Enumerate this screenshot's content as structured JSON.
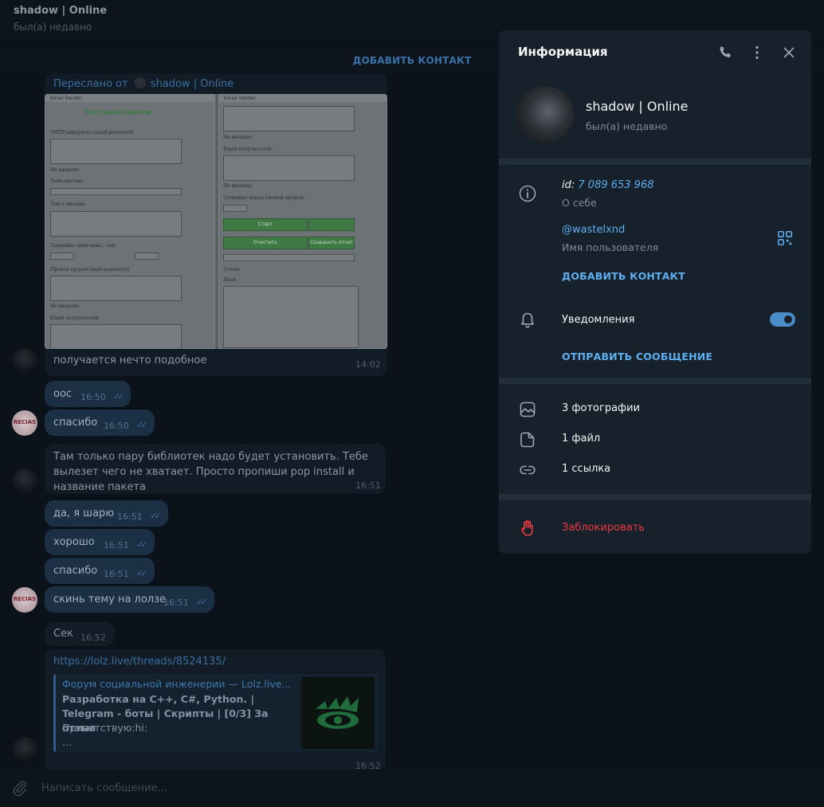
{
  "chat": {
    "title": "shadow | Online",
    "status": "был(а) недавно",
    "add_contact": "ДОБАВИТЬ КОНТАКТ",
    "forwarded_label": "Переслано от",
    "forwarded_from": "shadow | Online",
    "messages": [
      {
        "text": "получается нечто подобное",
        "time": "14:02"
      },
      {
        "text": "оос",
        "time": "16:50"
      },
      {
        "text": "спасибо",
        "time": "16:50"
      },
      {
        "text": "Там только пару библиотек надо будет установить. Тебе вылезет чего не хватает. Просто пропиши pop install и название пакета",
        "time": "16:51"
      },
      {
        "text": "да, я шарю",
        "time": "16:51"
      },
      {
        "text": "хорошо",
        "time": "16:51"
      },
      {
        "text": "спасибо",
        "time": "16:51"
      },
      {
        "text": "скинь тему на лолзе",
        "time": "16:51"
      },
      {
        "text": "Сек",
        "time": "16:52"
      }
    ],
    "link_message": {
      "url": "https://lolz.live/threads/8524135/",
      "site": "Форум социальной инженерии — Lolz.live...",
      "title": "Разработка на C++, C#, Python. | Telegram - боты | Скрипты | [0/3] За отзыв",
      "desc_line1": "Приветствую:hi:",
      "desc_line2": "...",
      "time": "16:52"
    },
    "avatar_text": "RECIAS",
    "composer_placeholder": "Написать сообщение..."
  },
  "screenshot_app": {
    "window_title": "Email Sender",
    "heading": "Рассылка писем",
    "left_labels": [
      "SMTP-аккаунты (email:password)",
      "Не введено",
      "Тема письма:",
      "Текст письма:",
      "Задержка (мин-макс, сек)",
      "Прокси (ip:port:login:password)",
      "Не введено",
      "Email получателей:"
    ],
    "right_labels": [
      "Не введено",
      "Email получателей:",
      "Не введено",
      "Отправка перед сменой прокси:",
      "Готово",
      "Логи:"
    ],
    "buttons": [
      "Старт",
      "Очистить",
      "Сохранить отчет"
    ]
  },
  "panel": {
    "title": "Информация",
    "name": "shadow | Online",
    "status": "был(а) недавно",
    "id_label": "id:",
    "id_value": "7 089 653 968",
    "about_label": "О себе",
    "username": "@wastelxnd",
    "username_label": "Имя пользователя",
    "add_contact": "ДОБАВИТЬ КОНТАКТ",
    "notifications": "Уведомления",
    "notifications_on": true,
    "send_message": "ОТПРАВИТЬ СООБЩЕНИЕ",
    "photos": "3 фотографии",
    "files": "1 файл",
    "links": "1 ссылка",
    "block": "Заблокировать"
  },
  "colors": {
    "accent": "#5eaef0",
    "danger": "#ec3942",
    "panel_bg": "#17212b",
    "chat_bg": "#0c121a"
  }
}
